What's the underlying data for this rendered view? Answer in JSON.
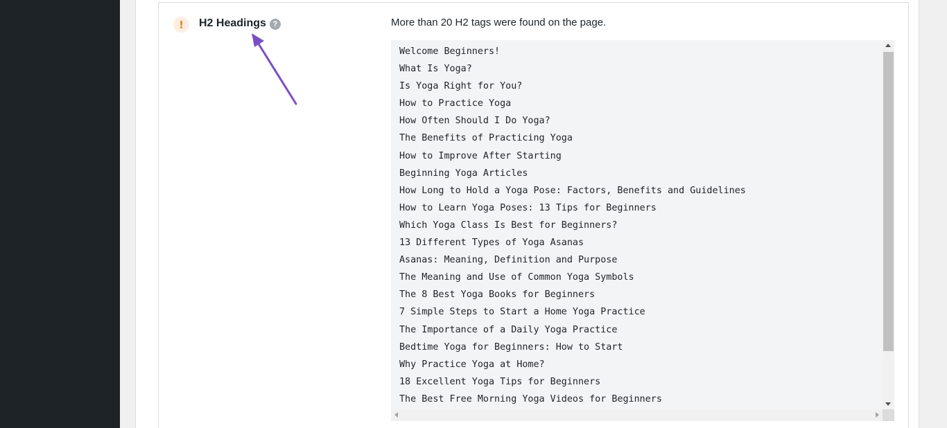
{
  "check": {
    "status_glyph": "!",
    "title": "H2 Headings",
    "help_glyph": "?",
    "message": "More than 20 H2 tags were found on the page."
  },
  "headings": [
    "Welcome Beginners!",
    "What Is Yoga?",
    "Is Yoga Right for You?",
    "How to Practice Yoga",
    "How Often Should I Do Yoga?",
    "The Benefits of Practicing Yoga",
    "How to Improve After Starting",
    "Beginning Yoga Articles",
    "How Long to Hold a Yoga Pose: Factors, Benefits and Guidelines",
    "How to Learn Yoga Poses: 13 Tips for Beginners",
    "Which Yoga Class Is Best for Beginners?",
    "13 Different Types of Yoga Asanas",
    "Asanas: Meaning, Definition and Purpose",
    "The Meaning and Use of Common Yoga Symbols",
    "The 8 Best Yoga Books for Beginners",
    "7 Simple Steps to Start a Home Yoga Practice",
    "The Importance of a Daily Yoga Practice",
    "Bedtime Yoga for Beginners: How to Start",
    "Why Practice Yoga at Home?",
    "18 Excellent Yoga Tips for Beginners",
    "The Best Free Morning Yoga Videos for Beginners"
  ],
  "colors": {
    "warning": "#f18200",
    "annotation_arrow": "#7b4fc4"
  },
  "icons": {
    "status": "warning-icon",
    "help": "help-icon",
    "annotation": "arrow-annotation"
  }
}
